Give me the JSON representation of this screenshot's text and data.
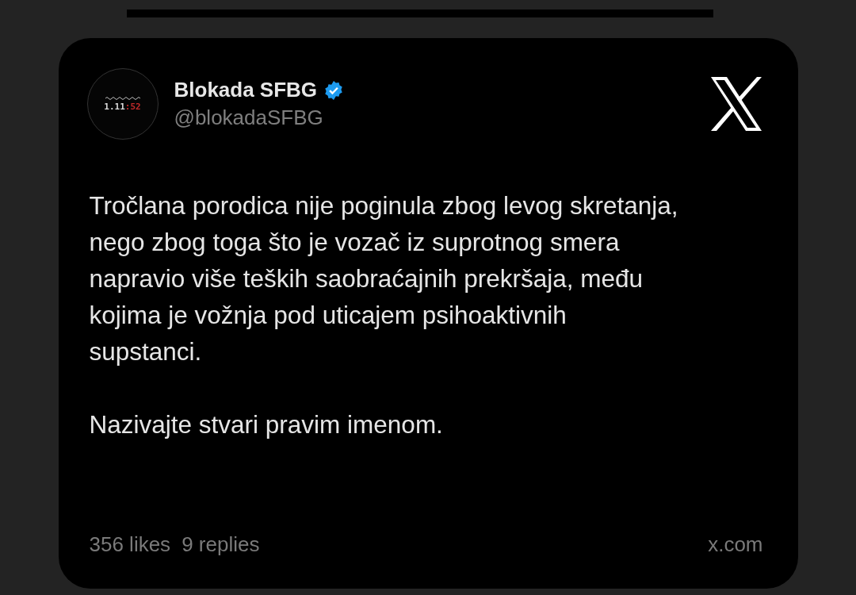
{
  "author": {
    "name": "Blokada SFBG",
    "verified": true,
    "handle": "@blokadaSFBG",
    "avatar": {
      "time": "1.11",
      "seconds": ":52"
    }
  },
  "body": [
    "Tročlana porodica nije poginula zbog levog skretanja, nego zbog toga što je vozač iz suprotnog smera napravio više teških saobraćajnih prekršaja, među kojima je vožnja pod uticajem psihoaktivnih supstanci.",
    "Nazivajte stvari pravim imenom."
  ],
  "footer": {
    "likes": "356 likes",
    "replies": "9 replies",
    "source": "x.com"
  }
}
